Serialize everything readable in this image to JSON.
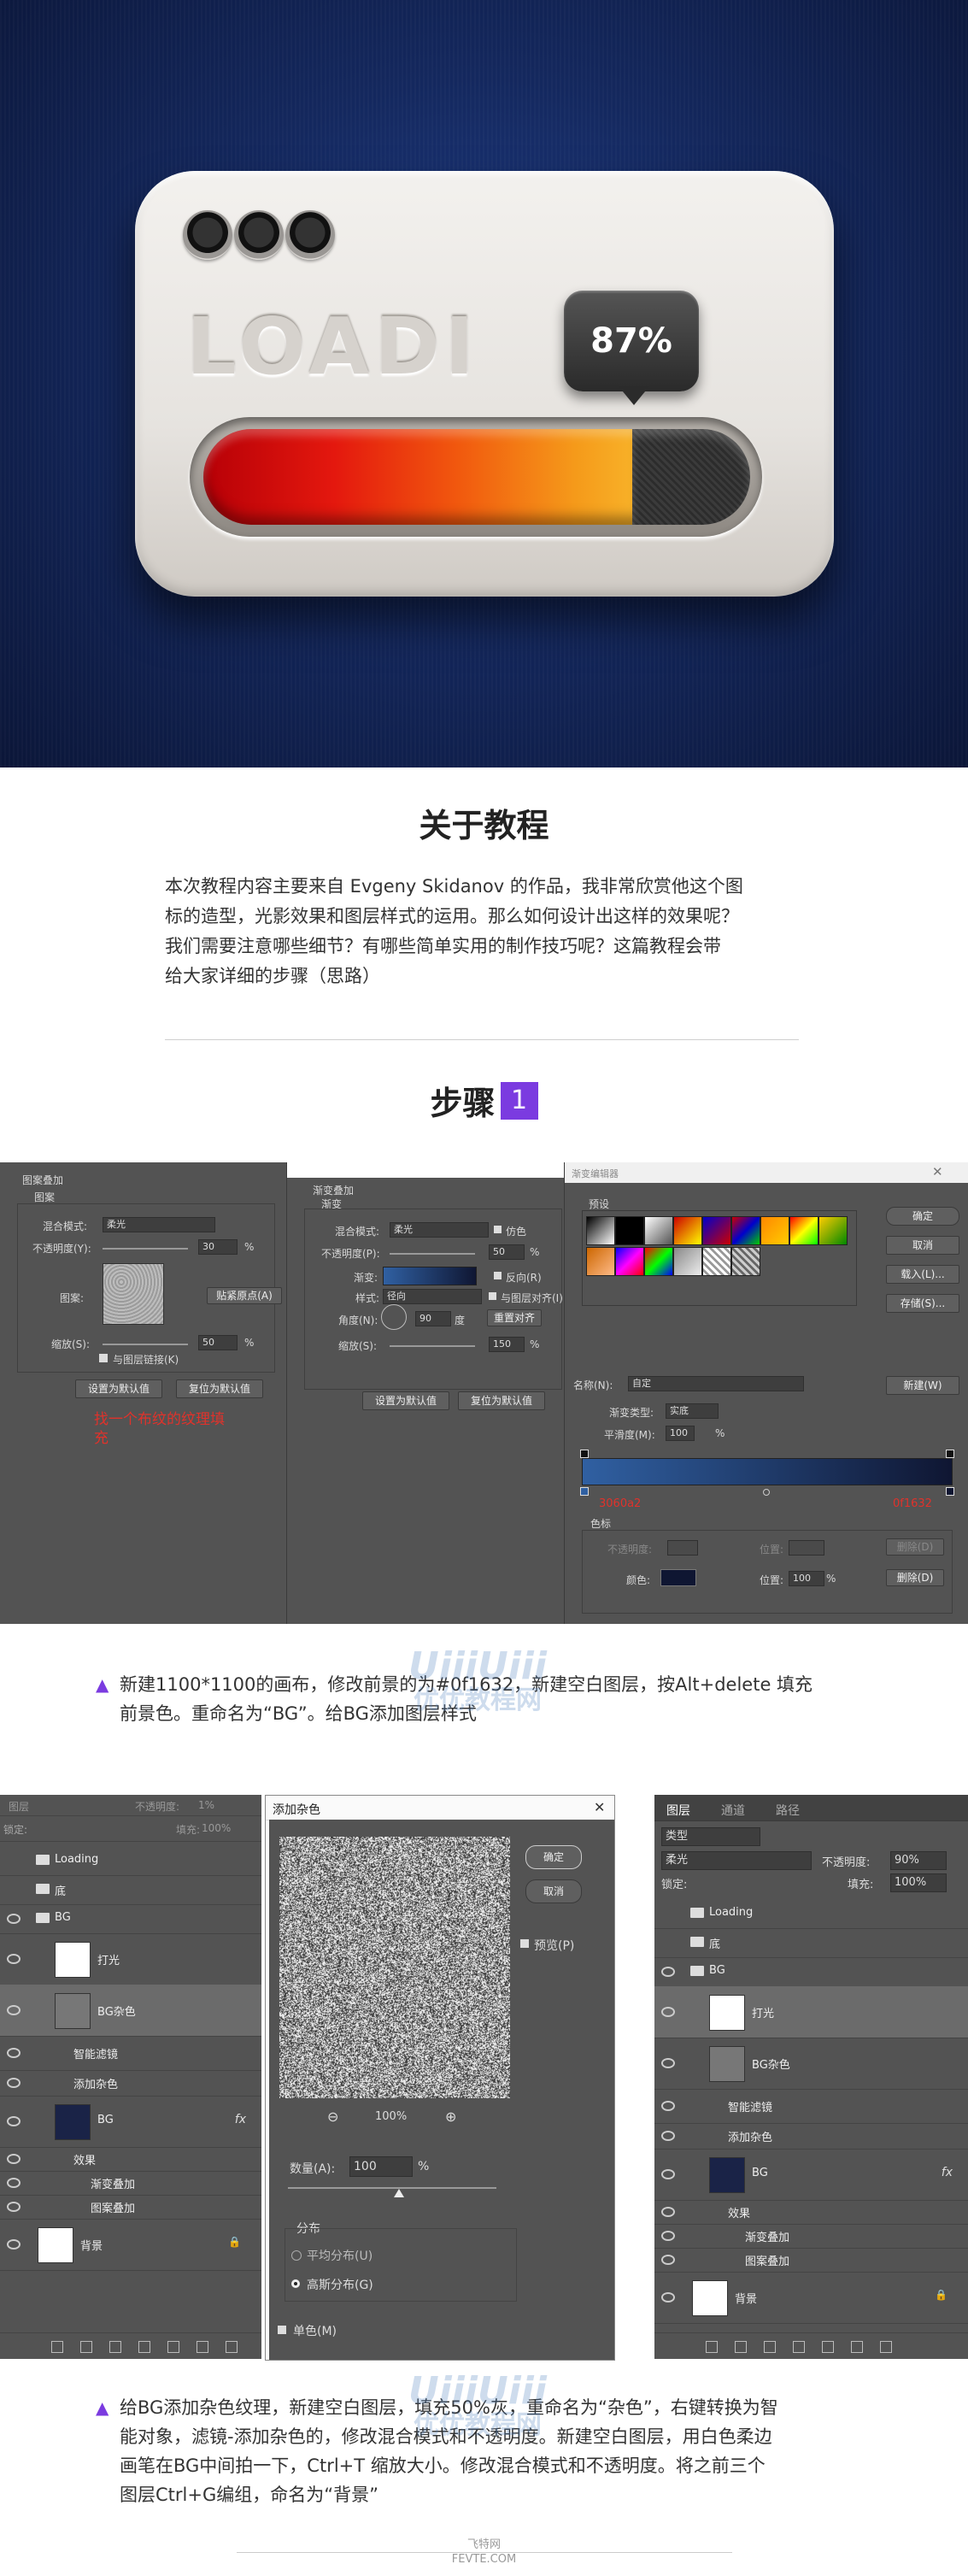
{
  "hero": {
    "loading_text": "LOADI",
    "percent": "87%",
    "progress_value": 0.87
  },
  "about": {
    "title": "关于教程",
    "paragraph_lines": [
      "本次教程内容主要来自 Evgeny Skidanov 的作品，我非常欣赏他这个图",
      "标的造型，光影效果和图层样式的运用。那么如何设计出这样的效果呢？",
      "我们需要注意哪些细节？有哪些简单实用的制作技巧呢？这篇教程会带",
      "给大家详细的步骤（思路）"
    ]
  },
  "step1": {
    "title": "步骤",
    "number": "1"
  },
  "panel_pattern": {
    "header": "图案叠加",
    "group": "图案",
    "blend_mode_label": "混合模式:",
    "blend_mode": "柔光",
    "opacity_label": "不透明度(Y):",
    "opacity": "30",
    "pct": "%",
    "pattern_label": "图案:",
    "snap_button": "贴紧原点(A)",
    "scale_label": "缩放(S):",
    "scale": "50",
    "link_label": "与图层链接(K)",
    "set_default": "设置为默认值",
    "reset_default": "复位为默认值",
    "note_line1": "找一个布纹的纹理填",
    "note_line2": "充"
  },
  "panel_gradient": {
    "header": "渐变叠加",
    "group": "渐变",
    "blend_mode_label": "混合模式:",
    "blend_mode": "柔光",
    "dither": "仿色",
    "opacity_label": "不透明度(P):",
    "opacity": "50",
    "pct": "%",
    "gradient_label": "渐变:",
    "reverse": "反向(R)",
    "style_label": "样式:",
    "style": "径向",
    "align": "与图层对齐(I)",
    "angle_label": "角度(N):",
    "angle": "90",
    "degree": "度",
    "reset_align": "重置对齐",
    "scale_label": "缩放(S):",
    "scale": "150",
    "set_default": "设置为默认值",
    "reset_default": "复位为默认值"
  },
  "gradient_editor": {
    "title": "渐变编辑器",
    "presets_label": "预设",
    "ok": "确定",
    "cancel": "取消",
    "load": "载入(L)...",
    "save": "存储(S)...",
    "name_label": "名称(N):",
    "name_value": "自定",
    "new_button": "新建(W)",
    "type_label": "渐变类型:",
    "type_value": "实底",
    "smooth_label": "平滑度(M):",
    "smooth_value": "100",
    "pct": "%",
    "left_color": "3060a2",
    "right_color": "0f1632",
    "color_stops_label": "色标",
    "opacity_stop_label": "不透明度:",
    "position_label": "位置:",
    "delete_button": "删除(D)",
    "color_label": "颜色:",
    "position_value": "100",
    "colors": {
      "left": "#3060a2",
      "right": "#0f1632"
    }
  },
  "caption1": {
    "lines": [
      "新建1100*1100的画布，修改前景的为#0f1632，新建空白图层，按Alt+delete 填充",
      "前景色。重命名为“BG”。给BG添加图层样式"
    ]
  },
  "watermark": {
    "line1": "UiiiUiii",
    "line2": "优优教程网"
  },
  "layers_left": {
    "top_label": "图层",
    "opacity_label": "不透明度:",
    "opacity": "1%",
    "lock_label": "锁定:",
    "fill_label": "填充:",
    "fill": "100%",
    "rows": [
      "Loading",
      "底",
      "BG",
      "打光",
      "BG杂色",
      "智能滤镜",
      "添加杂色",
      "BG",
      "效果",
      "渐变叠加",
      "图案叠加",
      "背景"
    ],
    "fx": "fx"
  },
  "noise_dialog": {
    "title": "添加杂色",
    "ok": "确定",
    "cancel": "取消",
    "preview": "预览(P)",
    "zoom": "100%",
    "amount_label": "数量(A):",
    "amount": "100",
    "pct": "%",
    "distribution": "分布",
    "uniform": "平均分布(U)",
    "gaussian": "高斯分布(G)",
    "mono": "单色(M)"
  },
  "layers_right": {
    "tabs": [
      "图层",
      "通道",
      "路径"
    ],
    "kind": "类型",
    "blend": "柔光",
    "opacity_label": "不透明度:",
    "opacity": "90%",
    "lock_label": "锁定:",
    "fill_label": "填充:",
    "fill": "100%",
    "rows": [
      "Loading",
      "底",
      "BG",
      "打光",
      "BG杂色",
      "智能滤镜",
      "添加杂色",
      "BG",
      "效果",
      "渐变叠加",
      "图案叠加",
      "背景"
    ],
    "fx": "fx"
  },
  "caption2": {
    "lines": [
      "给BG添加杂色纹理，新建空白图层，填充50%灰，重命名为“杂色”，右键转换为智",
      "能对象，滤镜-添加杂色的，修改混合模式和不透明度。新建空白图层，用白色柔边",
      "画笔在BG中间拍一下，Ctrl+T 缩放大小。修改混合模式和不透明度。将之前三个",
      "图层Ctrl+G编组，命名为“背景”"
    ]
  },
  "footer": {
    "line1": "飞特网",
    "line2": "FEVTE.COM"
  }
}
